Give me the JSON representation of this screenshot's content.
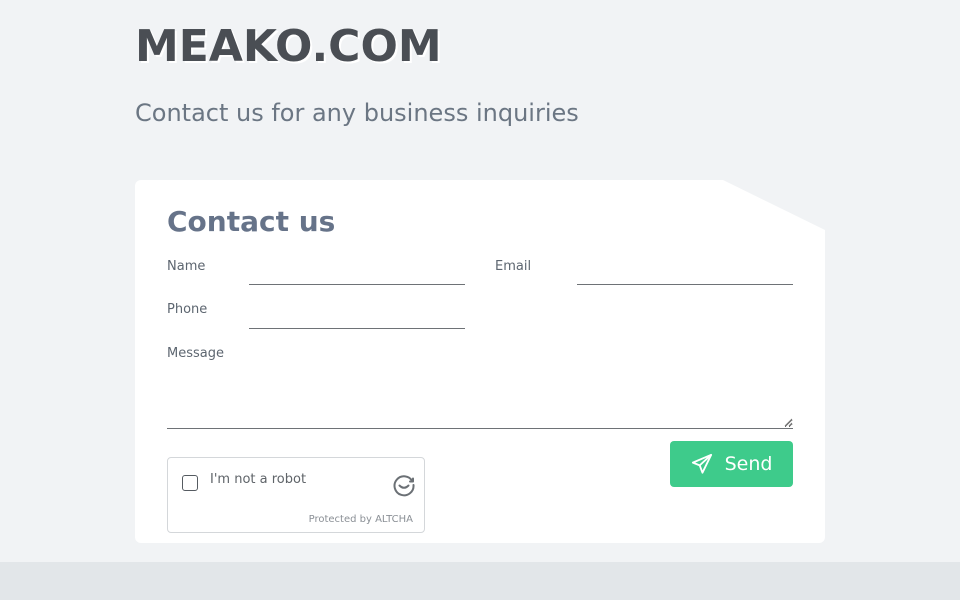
{
  "header": {
    "site_title": "MEAKO.COM",
    "subtitle": "Contact us for any business inquiries"
  },
  "form": {
    "title": "Contact us",
    "fields": {
      "name": {
        "label": "Name",
        "value": ""
      },
      "email": {
        "label": "Email",
        "value": ""
      },
      "phone": {
        "label": "Phone",
        "value": ""
      },
      "message": {
        "label": "Message",
        "value": ""
      }
    },
    "captcha": {
      "label": "I'm not a robot",
      "checked": false,
      "footer": "Protected by ALTCHA",
      "icon": "altcha-logo-icon"
    },
    "send_button": {
      "label": "Send",
      "icon": "paper-plane-icon",
      "color": "#3ecb8b"
    }
  },
  "colors": {
    "page_background": "#f1f3f5",
    "card_background": "#ffffff",
    "title_text": "#4a4e54",
    "form_title": "#667389"
  }
}
